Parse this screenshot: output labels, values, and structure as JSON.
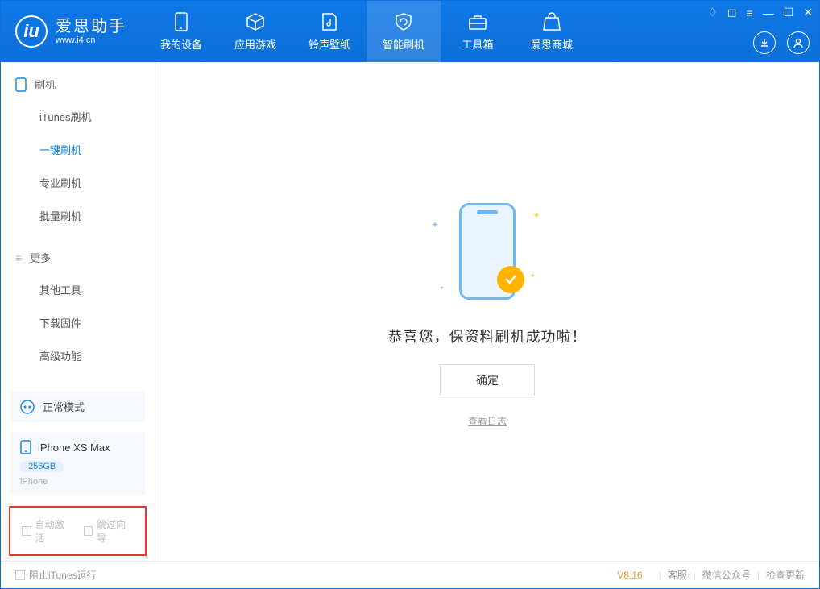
{
  "app": {
    "name_cn": "爱思助手",
    "name_en": "www.i4.cn"
  },
  "nav": {
    "items": [
      {
        "label": "我的设备"
      },
      {
        "label": "应用游戏"
      },
      {
        "label": "铃声壁纸"
      },
      {
        "label": "智能刷机"
      },
      {
        "label": "工具箱"
      },
      {
        "label": "爱思商城"
      }
    ]
  },
  "sidebar": {
    "section1": {
      "title": "刷机",
      "items": [
        "iTunes刷机",
        "一键刷机",
        "专业刷机",
        "批量刷机"
      ]
    },
    "section2": {
      "title": "更多",
      "items": [
        "其他工具",
        "下载固件",
        "高级功能"
      ]
    },
    "mode": "正常模式",
    "device": {
      "name": "iPhone XS Max",
      "storage": "256GB",
      "type": "iPhone"
    },
    "checks": {
      "auto_activate": "自动激活",
      "skip_guide": "跳过向导"
    }
  },
  "main": {
    "success_msg": "恭喜您，保资料刷机成功啦！",
    "ok": "确定",
    "view_log": "查看日志"
  },
  "status": {
    "block_itunes": "阻止iTunes运行",
    "version": "V8.16",
    "links": [
      "客服",
      "微信公众号",
      "检查更新"
    ]
  }
}
